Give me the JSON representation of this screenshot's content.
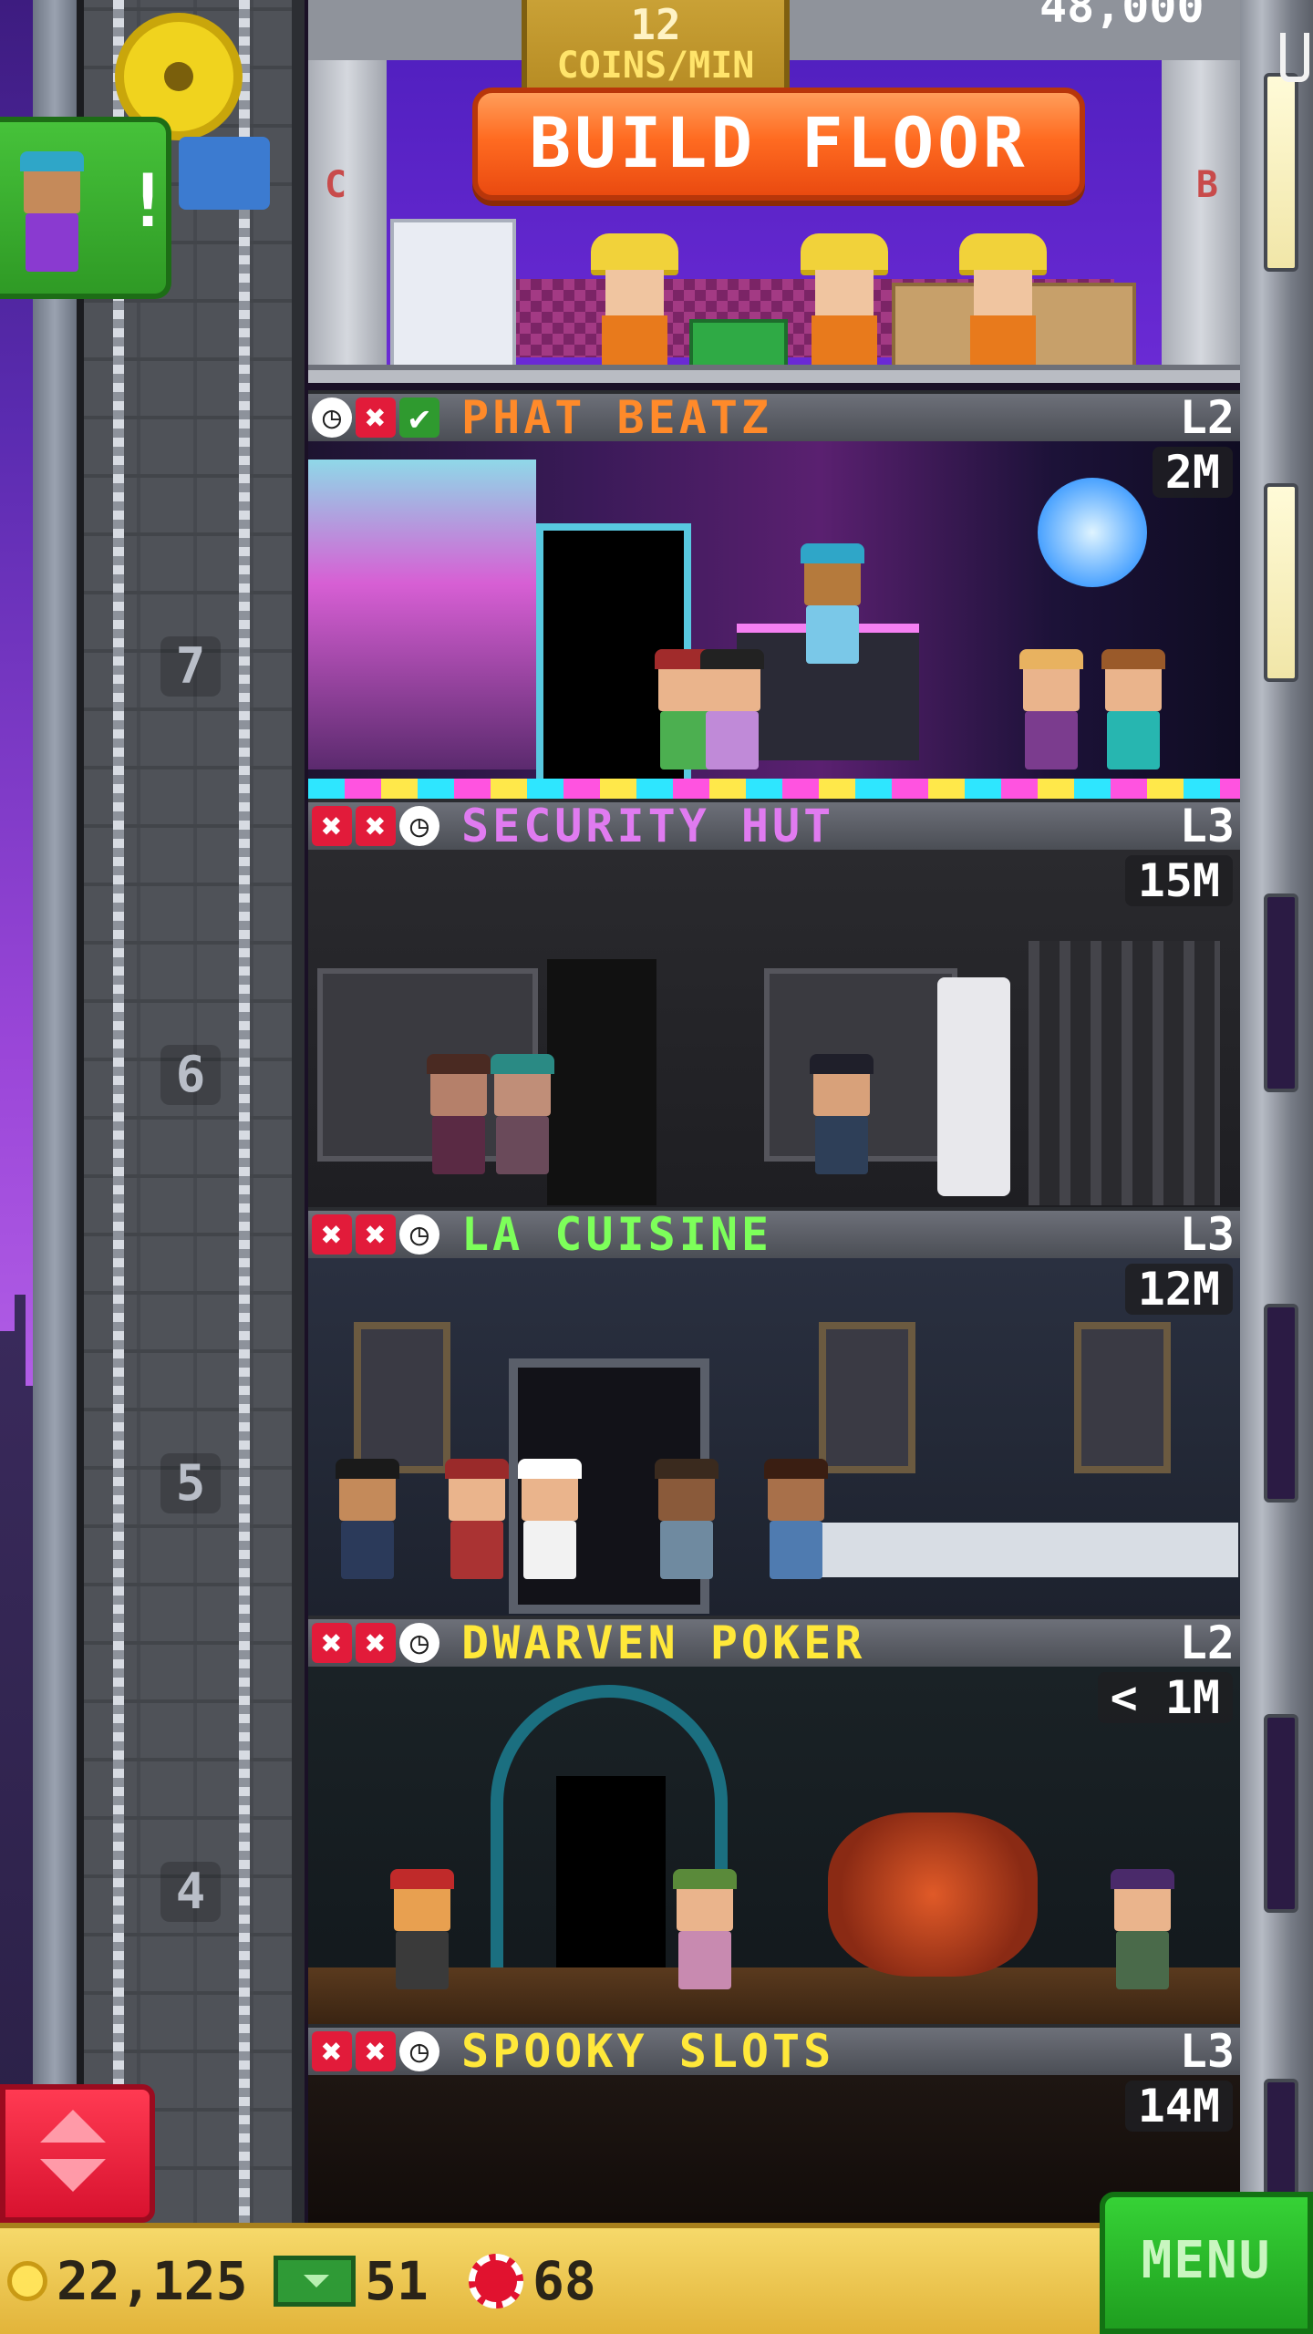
{
  "build": {
    "coins_rate": "12",
    "coins_unit": "COINS/MIN",
    "button_label": "BUILD FLOOR",
    "top_value": "48,000",
    "left_letter": "C",
    "right_letter": "B"
  },
  "elevator": {
    "floor_numbers": [
      "7",
      "6",
      "5",
      "4"
    ]
  },
  "floors": [
    {
      "name": "PHAT BEATZ",
      "level": "L2",
      "price": "2M",
      "name_color": "#ff8a2a",
      "icons": [
        "clock-icon",
        "x-icon",
        "check-icon"
      ]
    },
    {
      "name": "SECURITY HUT",
      "level": "L3",
      "price": "15M",
      "name_color": "#e07bf0",
      "icons": [
        "x-icon",
        "x-icon",
        "clock-icon"
      ]
    },
    {
      "name": "LA CUISINE",
      "level": "L3",
      "price": "12M",
      "name_color": "#7dff5a",
      "icons": [
        "x-icon",
        "x-icon",
        "clock-icon"
      ]
    },
    {
      "name": "DWARVEN POKER",
      "level": "L2",
      "price": "< 1M",
      "name_color": "#ffe83a",
      "icons": [
        "x-icon",
        "x-icon",
        "clock-icon"
      ]
    },
    {
      "name": "SPOOKY SLOTS",
      "level": "L3",
      "price": "14M",
      "name_color": "#ffe83a",
      "icons": [
        "x-icon",
        "x-icon",
        "clock-icon"
      ]
    }
  ],
  "status_bar": {
    "coins": "22,125",
    "bux": "51",
    "chips": "68",
    "menu_label": "MENU"
  },
  "colors": {
    "accent": "#ff6b21",
    "menu": "#1f9e1f",
    "elevator_button": "#d8122f"
  }
}
